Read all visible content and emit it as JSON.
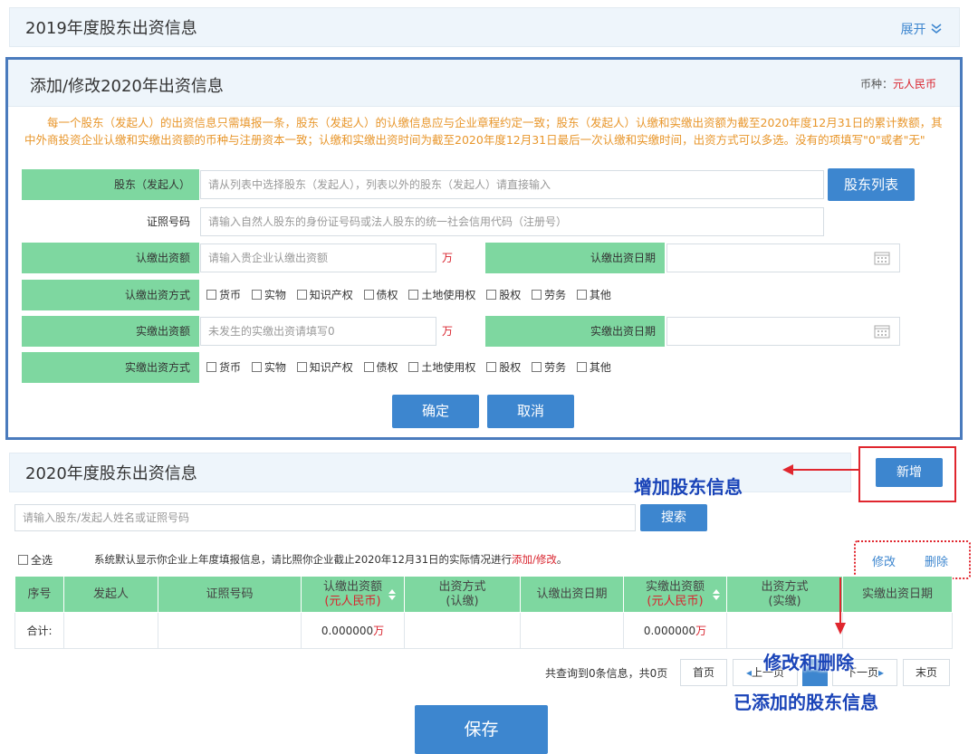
{
  "section2019": {
    "title": "2019年度股东出资信息",
    "expand_label": "展开"
  },
  "form": {
    "title": "添加/修改2020年出资信息",
    "currency_label": "币种：",
    "currency_value": "元人民币",
    "notice": "每一个股东（发起人）的出资信息只需填报一条，股东（发起人）的认缴信息应与企业章程约定一致；股东（发起人）认缴和实缴出资额为截至2020年度12月31日的累计数额，其中外商投资企业认缴和实缴出资额的币种与注册资本一致；认缴和实缴出资时间为截至2020年度12月31日最后一次认缴和实缴时间，出资方式可以多选。没有的项填写\"0\"或者\"无\"",
    "shareholder_label": "股东（发起人）",
    "shareholder_placeholder": "请从列表中选择股东（发起人），列表以外的股东（发起人）请直接输入",
    "shareholder_list_btn": "股东列表",
    "id_label": "证照号码",
    "id_placeholder": "请输入自然人股东的身份证号码或法人股东的统一社会信用代码（注册号）",
    "subscribed_amount_label": "认缴出资额",
    "subscribed_amount_placeholder": "请输入贵企业认缴出资额",
    "unit": "万",
    "subscribed_date_label": "认缴出资日期",
    "subscribed_method_label": "认缴出资方式",
    "paid_amount_label": "实缴出资额",
    "paid_amount_placeholder": "未发生的实缴出资请填写0",
    "paid_date_label": "实缴出资日期",
    "paid_method_label": "实缴出资方式",
    "methods": [
      "货币",
      "实物",
      "知识产权",
      "债权",
      "土地使用权",
      "股权",
      "劳务",
      "其他"
    ],
    "confirm_btn": "确定",
    "cancel_btn": "取消"
  },
  "section2020": {
    "title": "2020年度股东出资信息",
    "add_btn": "新增",
    "search_placeholder": "请输入股东/发起人姓名或证照号码",
    "search_btn": "搜索",
    "select_all": "全选",
    "hint_prefix": "系统默认显示你企业上年度填报信息，请比照你企业截止2020年12月31日的实际情况进行",
    "hint_link": "添加/修改",
    "hint_suffix": "。",
    "edit_link": "修改",
    "delete_link": "删除",
    "columns": {
      "seq": "序号",
      "initiator": "发起人",
      "id_no": "证照号码",
      "subscribed_amount": "认缴出资额",
      "currency": "(元人民币)",
      "method": "出资方式",
      "method_sub": "(认缴)",
      "subscribed_date": "认缴出资日期",
      "paid_amount": "实缴出资额",
      "method_paid_sub": "(实缴)",
      "paid_date": "实缴出资日期"
    },
    "total_row": {
      "label": "合计:",
      "subscribed_amount": "0.000000",
      "paid_amount": "0.000000",
      "unit": "万"
    },
    "pager": {
      "summary": "共查询到0条信息，共0页",
      "first": "首页",
      "prev": "上一页",
      "next": "下一页",
      "last": "末页"
    }
  },
  "save_btn": "保存",
  "annotations": {
    "add_info": "增加股东信息",
    "edit_delete_line1": "修改和删除",
    "edit_delete_line2": "已添加的股东信息"
  },
  "colors": {
    "accent": "#3d86cf",
    "label_bg": "#7ed7a0",
    "frame": "#4a7bbd",
    "alert": "#d9232d",
    "notice": "#e8962b",
    "annotation": "#1a44b8"
  }
}
